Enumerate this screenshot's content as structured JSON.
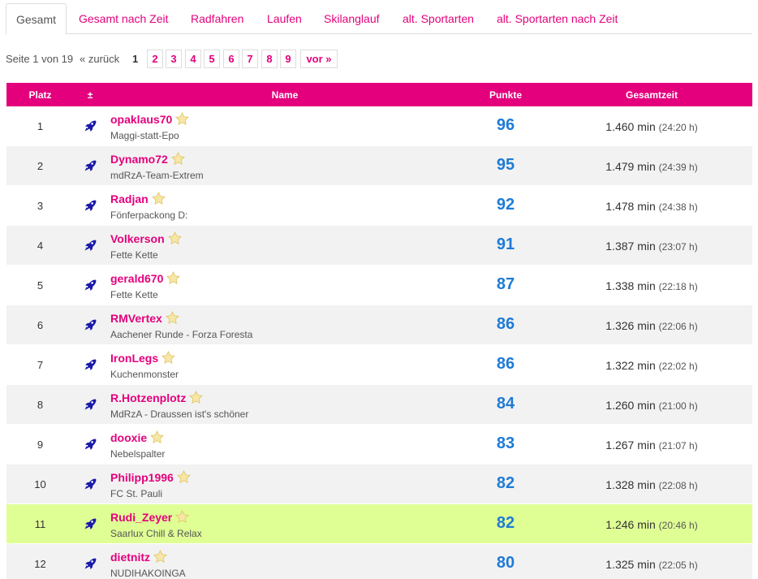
{
  "tabs": [
    {
      "label": "Gesamt",
      "active": true
    },
    {
      "label": "Gesamt nach Zeit"
    },
    {
      "label": "Radfahren"
    },
    {
      "label": "Laufen"
    },
    {
      "label": "Skilanglauf"
    },
    {
      "label": "alt. Sportarten"
    },
    {
      "label": "alt. Sportarten nach Zeit"
    }
  ],
  "pager": {
    "info": "Seite 1 von 19",
    "prev": "« zurück",
    "current": "1",
    "pages": [
      "2",
      "3",
      "4",
      "5",
      "6",
      "7",
      "8",
      "9"
    ],
    "next": "vor »"
  },
  "table": {
    "headers": {
      "platz": "Platz",
      "plusminus": "±",
      "name": "Name",
      "punkte": "Punkte",
      "gesamtzeit": "Gesamtzeit"
    },
    "rows": [
      {
        "platz": "1",
        "name": "opaklaus70",
        "team": "Maggi-statt-Epo",
        "punkte": "96",
        "zeit": "1.460 min",
        "stunden": "(24:20 h)"
      },
      {
        "platz": "2",
        "name": "Dynamo72",
        "team": "mdRzA-Team-Extrem",
        "punkte": "95",
        "zeit": "1.479 min",
        "stunden": "(24:39 h)"
      },
      {
        "platz": "3",
        "name": "Radjan",
        "team": "Fönferpackong D:",
        "punkte": "92",
        "zeit": "1.478 min",
        "stunden": "(24:38 h)"
      },
      {
        "platz": "4",
        "name": "Volkerson",
        "team": "Fette Kette",
        "punkte": "91",
        "zeit": "1.387 min",
        "stunden": "(23:07 h)"
      },
      {
        "platz": "5",
        "name": "gerald670",
        "team": "Fette Kette",
        "punkte": "87",
        "zeit": "1.338 min",
        "stunden": "(22:18 h)"
      },
      {
        "platz": "6",
        "name": "RMVertex",
        "team": "Aachener Runde - Forza Foresta",
        "punkte": "86",
        "zeit": "1.326 min",
        "stunden": "(22:06 h)"
      },
      {
        "platz": "7",
        "name": "IronLegs",
        "team": "Kuchenmonster",
        "punkte": "86",
        "zeit": "1.322 min",
        "stunden": "(22:02 h)"
      },
      {
        "platz": "8",
        "name": "R.Hotzenplotz",
        "team": "MdRzA - Draussen ist's schöner",
        "punkte": "84",
        "zeit": "1.260 min",
        "stunden": "(21:00 h)"
      },
      {
        "platz": "9",
        "name": "dooxie",
        "team": "Nebelspalter",
        "punkte": "83",
        "zeit": "1.267 min",
        "stunden": "(21:07 h)"
      },
      {
        "platz": "10",
        "name": "Philipp1996",
        "team": "FC St. Pauli",
        "punkte": "82",
        "zeit": "1.328 min",
        "stunden": "(22:08 h)"
      },
      {
        "platz": "11",
        "name": "Rudi_Zeyer",
        "team": "Saarlux Chill & Relax",
        "punkte": "82",
        "zeit": "1.246 min",
        "stunden": "(20:46 h)",
        "highlight": true
      },
      {
        "platz": "12",
        "name": "dietnitz",
        "team": "NUDIHAKOINGA",
        "punkte": "80",
        "zeit": "1.325 min",
        "stunden": "(22:05 h)"
      }
    ]
  },
  "colors": {
    "accent": "#e4007c",
    "points": "#1e7bd6",
    "highlight": "#dfff95",
    "rocket": "#1a1aa8",
    "star": "#f3dc8a"
  },
  "icons": {
    "trend": "rocket-icon",
    "badge": "star-icon"
  }
}
